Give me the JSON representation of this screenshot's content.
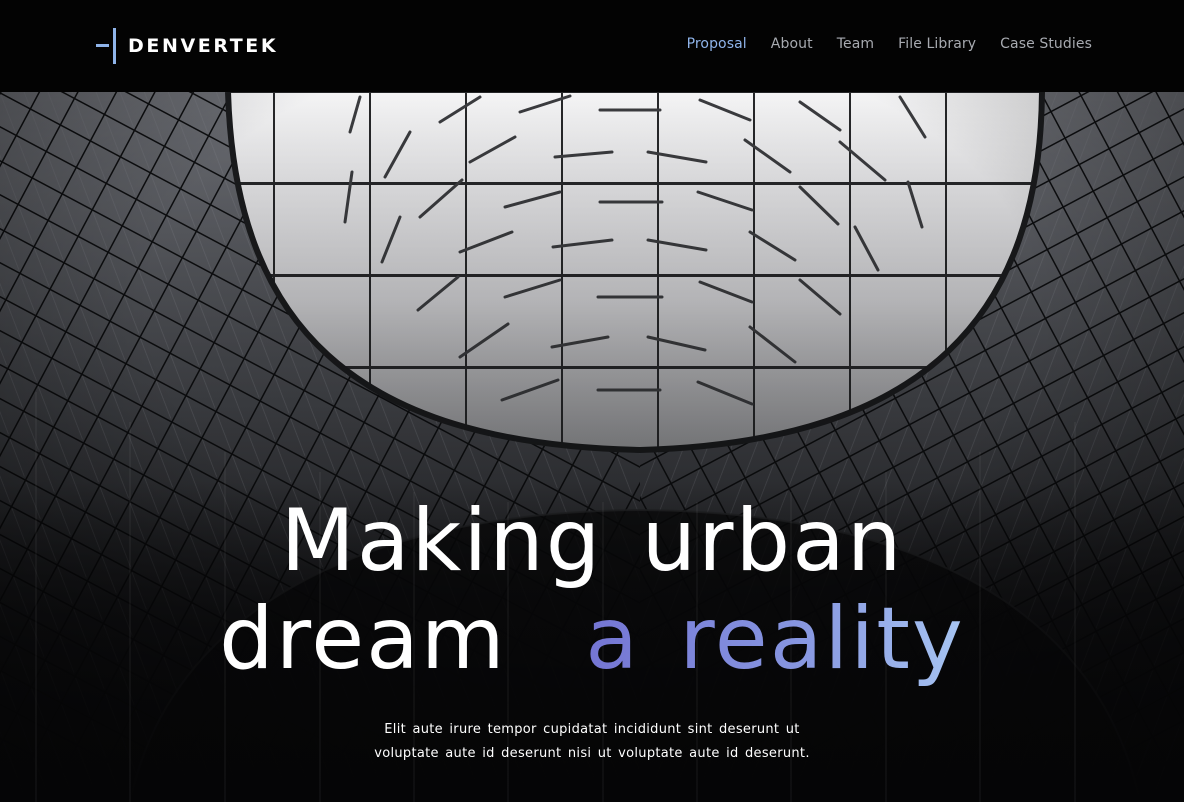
{
  "brand": {
    "name": "DENVERTEK",
    "accent_color": "#8fb4ea"
  },
  "nav": {
    "items": [
      {
        "label": "Proposal",
        "active": true
      },
      {
        "label": "About",
        "active": false
      },
      {
        "label": "Team",
        "active": false
      },
      {
        "label": "File Library",
        "active": false
      },
      {
        "label": "Case Studies",
        "active": false
      }
    ]
  },
  "hero": {
    "headline_line1": "Making urban",
    "headline_line2_start": "dream",
    "headline_line2_accent": "a reality",
    "subtext_line1": "Elit aute irure tempor cupidatat incididunt sint deserunt ut",
    "subtext_line2": "voluptate aute id deserunt nisi ut voluptate aute id deserunt.",
    "accent_gradient": [
      "#7475d3",
      "#8695e0",
      "#a7c5f2"
    ],
    "background_image": "architecture-photo-glass-ceiling"
  }
}
